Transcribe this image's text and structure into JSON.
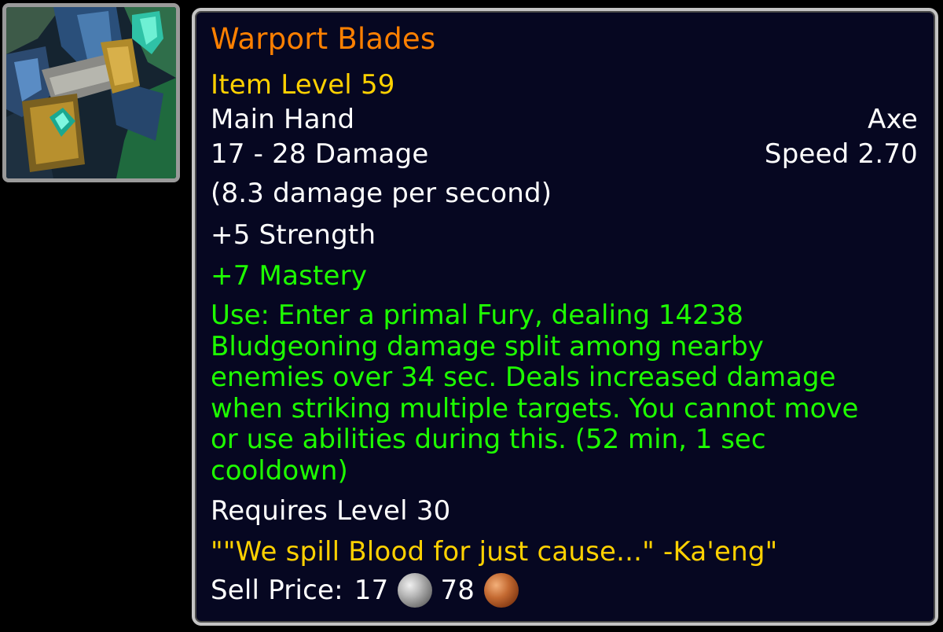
{
  "item": {
    "name": "Warport Blades",
    "item_level": "Item Level 59",
    "slot": "Main Hand",
    "type": "Axe",
    "damage": "17 - 28 Damage",
    "speed": "Speed 2.70",
    "dps": "(8.3 damage per second)",
    "stat_primary": "+5 Strength",
    "stat_secondary": "+7 Mastery",
    "use_effect": "Use: Enter a primal Fury, dealing 14238\nBludgeoning damage split among nearby\nenemies over 34 sec. Deals increased damage\nwhen striking multiple targets. You cannot move\nor use abilities during this. (52 min, 1 sec\ncooldown)",
    "requirement": "Requires Level 30",
    "flavor_text": "\"\"We spill Blood for just cause...\" -Ka'eng\"",
    "sell_label": "Sell Price:",
    "sell_silver": "17",
    "sell_copper": "78"
  },
  "icons": {
    "item_icon": "axe-item-icon",
    "silver": "silver-coin-icon",
    "copper": "copper-coin-icon"
  },
  "colors": {
    "legendary_orange": "#ff8000",
    "gold": "#ffd100",
    "green": "#1eff00",
    "white": "#ffffff",
    "tooltip_bg": "#060721",
    "border": "#c4c4c4"
  }
}
